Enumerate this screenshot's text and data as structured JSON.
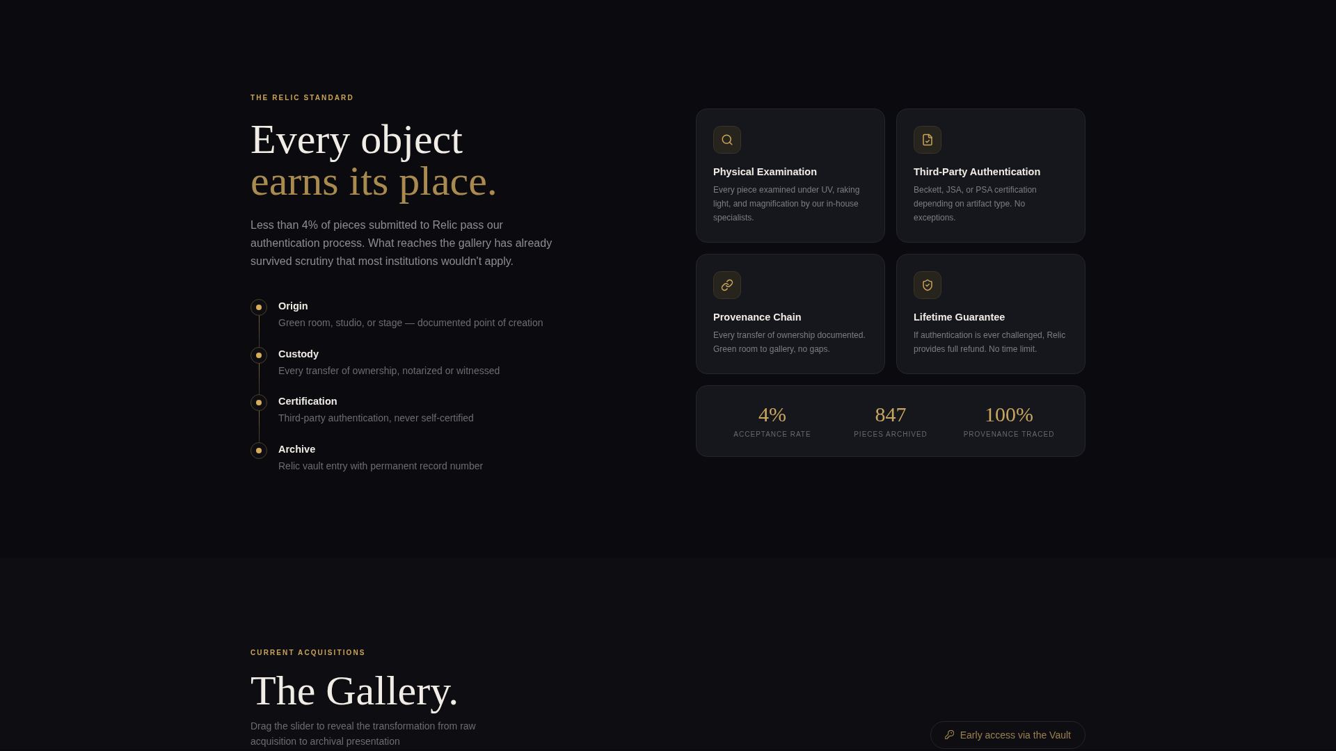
{
  "standard": {
    "eyebrow": "THE RELIC STANDARD",
    "heading": "Every object",
    "heading_accent": "earns its place.",
    "intro": "Less than 4% of pieces submitted to Relic pass our authentication process. What reaches the gallery has already survived scrutiny that most institutions wouldn't apply.",
    "timeline": [
      {
        "title": "Origin",
        "description": "Green room, studio, or stage — documented point of creation"
      },
      {
        "title": "Custody",
        "description": "Every transfer of ownership, notarized or witnessed"
      },
      {
        "title": "Certification",
        "description": "Third-party authentication, never self-certified"
      },
      {
        "title": "Archive",
        "description": "Relic vault entry with permanent record number"
      }
    ]
  },
  "features": [
    {
      "title": "Physical Examination",
      "description": "Every piece examined under UV, raking light, and magnification by our in-house specialists."
    },
    {
      "title": "Third-Party Authentication",
      "description": "Beckett, JSA, or PSA certification depending on artifact type. No exceptions."
    },
    {
      "title": "Provenance Chain",
      "description": "Every transfer of ownership documented. Green room to gallery, no gaps."
    },
    {
      "title": "Lifetime Guarantee",
      "description": "If authentication is ever challenged, Relic provides full refund. No time limit."
    }
  ],
  "stats": [
    {
      "value": "4%",
      "label": "ACCEPTANCE RATE"
    },
    {
      "value": "847",
      "label": "PIECES ARCHIVED"
    },
    {
      "value": "100%",
      "label": "PROVENANCE TRACED"
    }
  ],
  "gallery": {
    "eyebrow": "CURRENT ACQUISITIONS",
    "heading": "The Gallery.",
    "intro": "Drag the slider to reveal the transformation from raw acquisition to archival presentation",
    "button": "Early access via the Vault"
  }
}
